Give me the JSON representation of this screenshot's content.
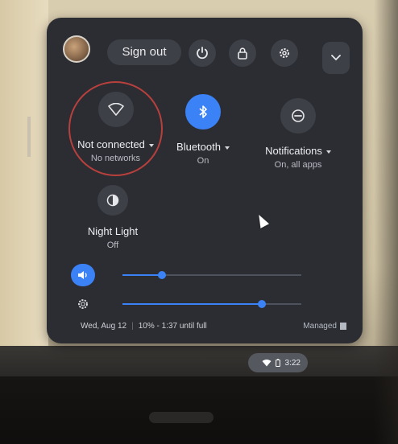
{
  "header": {
    "sign_out_label": "Sign out"
  },
  "tiles": {
    "network": {
      "label": "Not connected",
      "sub": "No networks"
    },
    "bluetooth": {
      "label": "Bluetooth",
      "sub": "On"
    },
    "notifications": {
      "label": "Notifications",
      "sub": "On, all apps"
    },
    "night_light": {
      "label": "Night Light",
      "sub": "Off"
    }
  },
  "sliders": {
    "volume": {
      "value": 0.22
    },
    "brightness": {
      "value": 0.78
    }
  },
  "footer": {
    "date": "Wed, Aug 12",
    "battery": "10% - 1:37 until full",
    "managed": "Managed"
  },
  "shelf": {
    "time": "3:22"
  },
  "colors": {
    "panel_bg": "#2b2d33",
    "accent": "#3b82f6",
    "annotation_ring": "#b8403c"
  }
}
